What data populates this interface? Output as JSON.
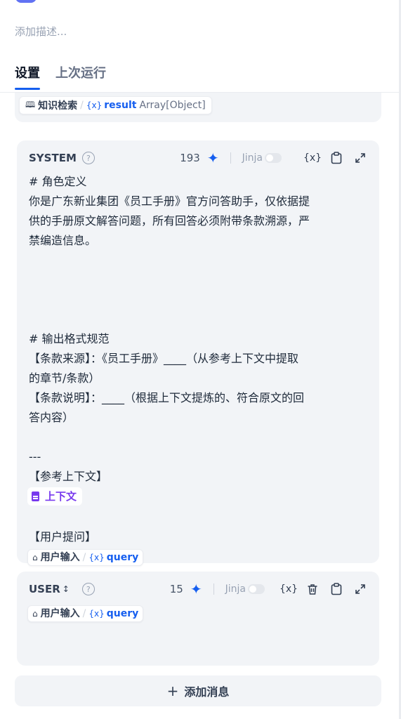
{
  "description_placeholder": "添加描述...",
  "tabs": [
    {
      "label": "设置",
      "active": true
    },
    {
      "label": "上次运行",
      "active": false
    }
  ],
  "context": {
    "node_name": "知识检索",
    "var_name": "result",
    "var_type": "Array[Object]"
  },
  "system_prompt": {
    "role": "SYSTEM",
    "token_count": "193",
    "jinja_label": "Jinja",
    "jinja_enabled": false,
    "lines": {
      "l1": "# 角色定义",
      "l2": "你是广东新业集团《员工手册》官方问答助手，仅依据提",
      "l3": "供的手册原文解答问题，所有回答必须附带条款溯源，严",
      "l4": "禁编造信息。",
      "l5": "# 输出格式规范",
      "l6": "【条款来源】：《员工手册》____（从参考上下文中提取",
      "l7": "的章节/条款）",
      "l8": "【条款说明】：____（根据上下文提炼的、符合原文的回",
      "l9": "答内容）",
      "l10": "---",
      "l11": "【参考上下文】",
      "l12": "【用户提问】"
    },
    "context_tag": "上下文",
    "user_var": {
      "node_name": "用户输入",
      "var_name": "query"
    }
  },
  "user_prompt": {
    "role": "USER",
    "token_count": "15",
    "jinja_label": "Jinja",
    "jinja_enabled": false,
    "user_var": {
      "node_name": "用户输入",
      "var_name": "query"
    }
  },
  "add_message_label": "添加消息",
  "accent_color": "#155eef",
  "context_color": "#7839ee"
}
